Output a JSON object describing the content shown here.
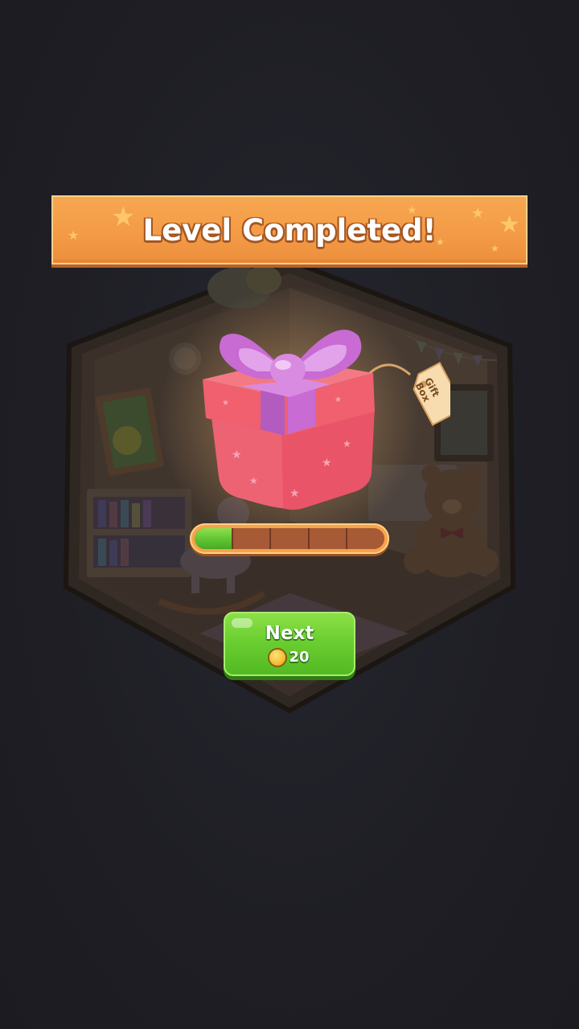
{
  "banner": {
    "title": "Level Completed!"
  },
  "reward": {
    "tag_label": "Gift Box",
    "progress": 0.2,
    "segments": 5
  },
  "next_button": {
    "label": "Next",
    "cost": "20",
    "coin_icon": "coin-icon"
  },
  "colors": {
    "banner": "#f39a46",
    "button": "#6bcf31",
    "progress_fill": "#5cc12f",
    "gift_box": "#ef5a6a",
    "ribbon": "#c86bd3"
  }
}
